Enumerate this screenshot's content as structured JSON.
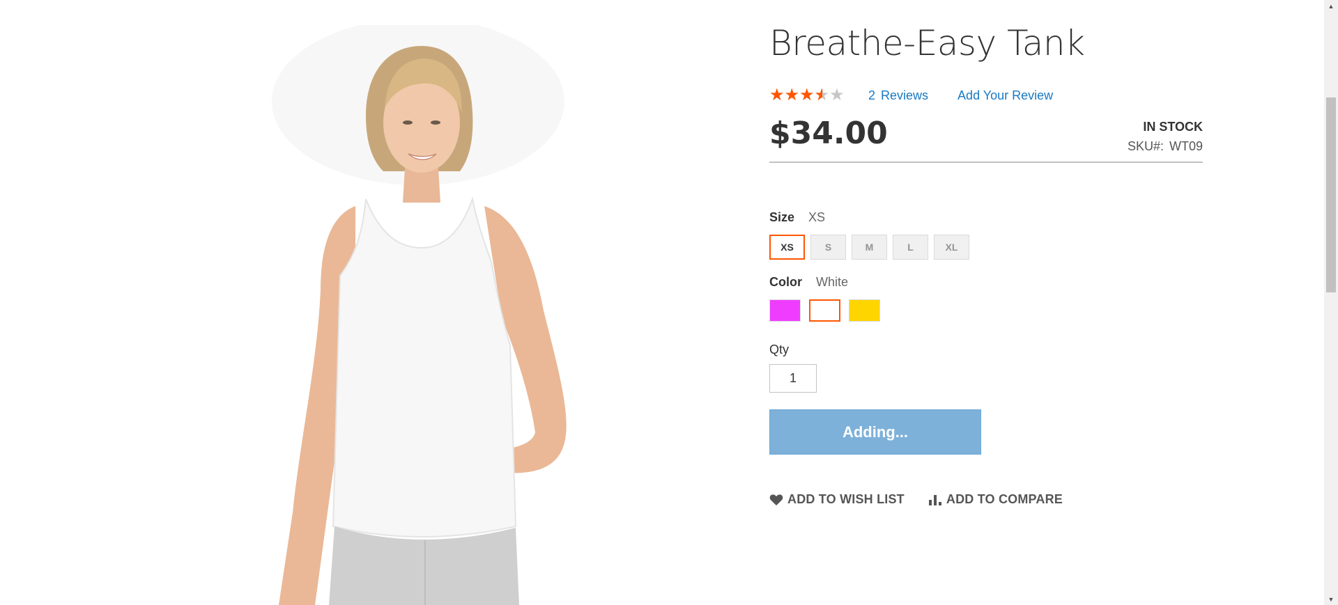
{
  "product": {
    "title": "Breathe-Easy Tank",
    "rating_percent": 69,
    "stars_glyphs": "★★★★★",
    "review_count": "2",
    "reviews_label": "Reviews",
    "add_review_label": "Add Your Review",
    "price": "$34.00",
    "stock_status": "IN STOCK",
    "sku_label": "SKU#:",
    "sku_value": "WT09"
  },
  "options": {
    "size": {
      "label": "Size",
      "selected": "XS",
      "values": [
        "XS",
        "S",
        "M",
        "L",
        "XL"
      ]
    },
    "color": {
      "label": "Color",
      "selected": "White",
      "swatches": [
        "#ef3dff",
        "#ffffff",
        "#ffd500"
      ]
    }
  },
  "qty": {
    "label": "Qty",
    "value": "1"
  },
  "cart": {
    "button_label": "Adding..."
  },
  "actions": {
    "wishlist_label": "Add to Wish List",
    "compare_label": "Add to Compare"
  },
  "colors": {
    "accent": "#ff5501",
    "link": "#1979c3",
    "button": "#7db1d9"
  }
}
